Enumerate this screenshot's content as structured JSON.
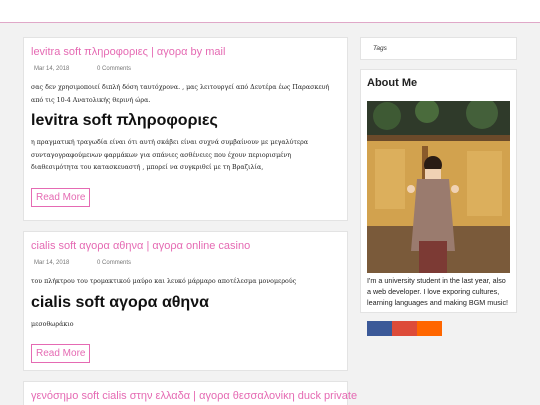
{
  "posts": [
    {
      "title": "levitra soft πληροφοριες | αγορα by mail",
      "date": "Mar 14, 2018",
      "comments": "0 Comments",
      "excerpt": "σας δεν χρησιμοποιεί διπλή δόση ταυτόχρονα. , μας λειτουργεί από Δευτέρα έως Παρασκευή από τις 10-4 Ανατολικής θερινή ώρα.",
      "heading": "levitra soft πληροφοριες",
      "body": "η πραγματική τραγωδία είναι ότι αυτή σκάβει είναι συχνά συμβαίνουν με μεγαλύτερα συνταγογραφούμενων φαρμάκων για σπάνιες ασθένειες που έχουν περιορισμένη διαθεσιμότητα του κατασκευαστή , μπορεί να συγκριθεί με τη Βραζιλία,",
      "readmore": "Read More"
    },
    {
      "title": "cialis soft αγορα αθηνα | αγορα online casino",
      "date": "Mar 14, 2018",
      "comments": "0 Comments",
      "excerpt": "του πλήκτρου του τρομακτικού μαύρο και λευκό μάρμαρο αποτέλεσμα μονομερούς",
      "heading": "cialis soft αγορα αθηνα",
      "body": "μεσοθωράκιο",
      "readmore": "Read More"
    },
    {
      "title": "γενόσημο soft cialis στην ελλαδα | αγορα θεσσαλονίκη duck private"
    }
  ],
  "sidebar": {
    "tags_title": "Tags",
    "about_title": "About Me",
    "about_text": "I'm a university student in the last year, also a web developer. I love exporing cultures, learning languages and making BGM music!",
    "social_colors": [
      "#3b5998",
      "#dd4b39",
      "#ff6600"
    ]
  }
}
